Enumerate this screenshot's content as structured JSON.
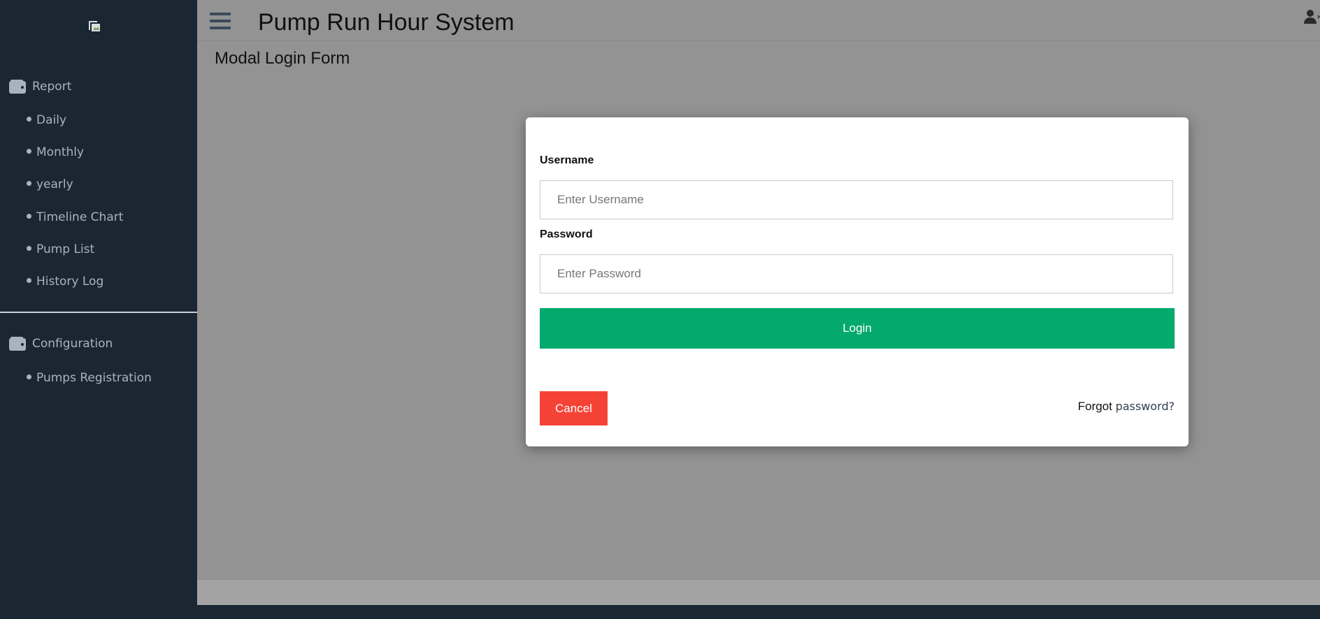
{
  "sidebar": {
    "logo_alt": "",
    "sections": [
      {
        "title": "Report",
        "icon": "wallet-icon"
      },
      {
        "title": "Configuration",
        "icon": "wallet-icon"
      }
    ],
    "report_items": [
      "Daily",
      "Monthly",
      "yearly",
      "Timeline Chart",
      "Pump List",
      "History Log"
    ],
    "config_items": [
      "Pumps Registration"
    ]
  },
  "header": {
    "title": "Pump Run Hour System",
    "menu_icon": "hamburger-icon",
    "user_icon": "user-icon"
  },
  "page": {
    "heading": "Modal Login Form"
  },
  "login_modal": {
    "username_label": "Username",
    "username_placeholder": "Enter Username",
    "username_value": "",
    "password_label": "Password",
    "password_placeholder": "Enter Password",
    "password_value": "",
    "login_label": "Login",
    "cancel_label": "Cancel",
    "forgot_prefix": "Forgot",
    "forgot_link": "password?"
  },
  "colors": {
    "sidebar_bg": "#1b2633",
    "overlay_bg": "#939393",
    "login_button": "#04aa6d",
    "cancel_button": "#f44336"
  }
}
